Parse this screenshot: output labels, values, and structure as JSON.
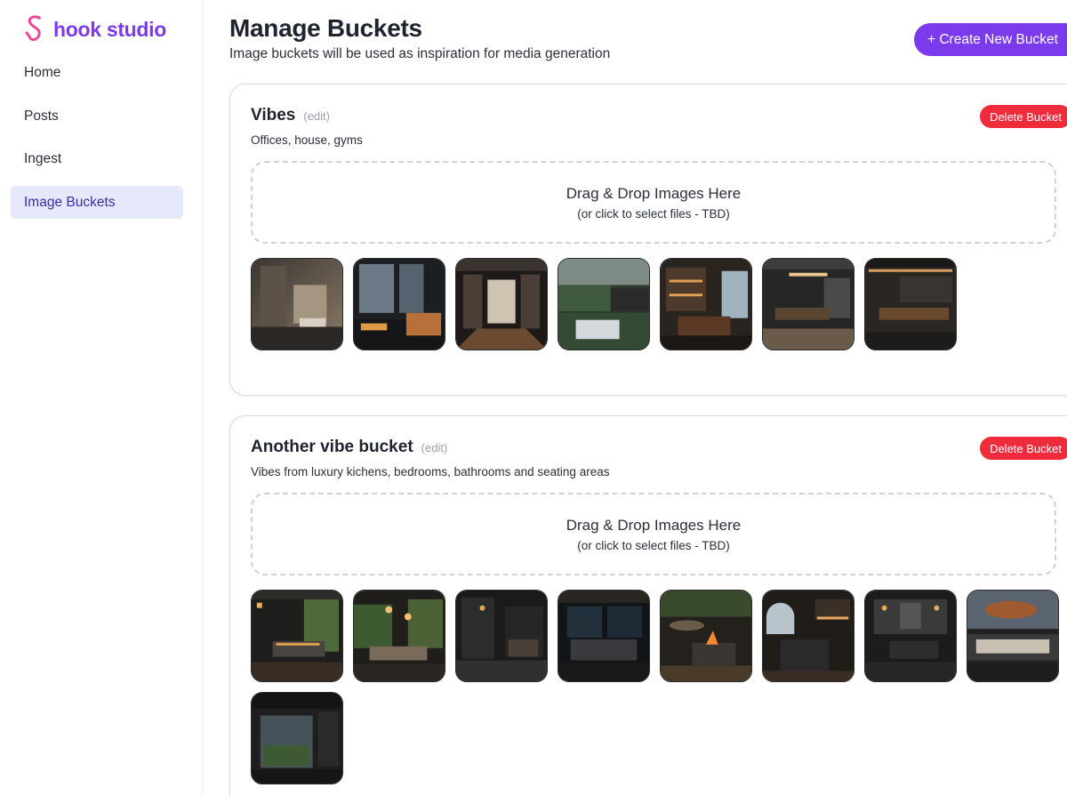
{
  "sidebar": {
    "brand": {
      "name": "hook studio",
      "logo_icon": "hook-logo-icon",
      "logo_color": "#ec4899",
      "text_color": "#7c3aed"
    },
    "items": [
      {
        "label": "Home",
        "active": false
      },
      {
        "label": "Posts",
        "active": false
      },
      {
        "label": "Ingest",
        "active": false
      },
      {
        "label": "Image Buckets",
        "active": true
      }
    ]
  },
  "header": {
    "title": "Manage Buckets",
    "subtitle": "Image buckets will be used as inspiration for media generation",
    "create_button": "+ Create New Bucket"
  },
  "buckets": [
    {
      "name": "Vibes",
      "edit_label": "(edit)",
      "description": "Offices, house, gyms",
      "delete_label": "Delete Bucket",
      "dropzone": {
        "title": "Drag & Drop Images Here",
        "subtitle": "(or click to select files - TBD)"
      },
      "images": [
        "interior-photo",
        "interior-photo",
        "interior-photo",
        "interior-photo",
        "interior-photo",
        "interior-photo",
        "interior-photo"
      ]
    },
    {
      "name": "Another vibe bucket",
      "edit_label": "(edit)",
      "description": "Vibes from luxury kichens, bedrooms, bathrooms and seating areas",
      "delete_label": "Delete Bucket",
      "dropzone": {
        "title": "Drag & Drop Images Here",
        "subtitle": "(or click to select files - TBD)"
      },
      "images": [
        "interior-photo",
        "interior-photo",
        "interior-photo",
        "interior-photo",
        "interior-photo",
        "interior-photo",
        "interior-photo",
        "interior-photo",
        "interior-photo"
      ]
    }
  ],
  "colors": {
    "accent": "#7c3aed",
    "danger": "#ef2b3c",
    "nav_active_bg": "#e6e9fc"
  }
}
